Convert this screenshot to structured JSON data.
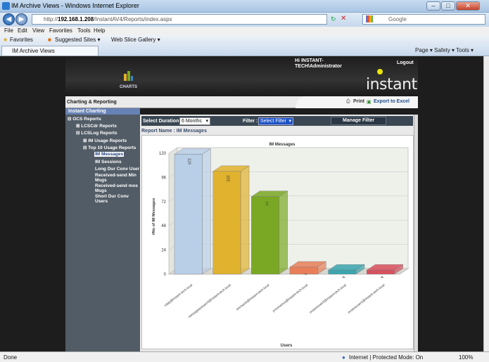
{
  "window": {
    "title": "IM Archive Views - Windows Internet Explorer",
    "min": "–",
    "max": "□",
    "close": "✕"
  },
  "address": {
    "url_prefix": "http://",
    "url_host": "192.168.1.208",
    "url_path": "/InstantAV4/Reports/index.aspx",
    "search_placeholder": "Google"
  },
  "menu": [
    "File",
    "Edit",
    "View",
    "Favorites",
    "Tools",
    "Help"
  ],
  "favorites": {
    "label": "Favorites",
    "items": [
      "Suggested Sites ▾",
      "Web Slice Gallery ▾"
    ]
  },
  "tab": {
    "label": "IM Archive Views",
    "tools": "Page ▾   Safety ▾   Tools ▾"
  },
  "header": {
    "greeting": "Hi INSTANT-\nTECH\\Administrator",
    "logout": "Logout",
    "charts_label": "CHARTS",
    "brand": "instant"
  },
  "subheader": {
    "crumb": "Charting & Reporting",
    "print": "Print",
    "export": "Export to Excel"
  },
  "sidebar": {
    "heading": "Instant Charting",
    "items": [
      {
        "label": "⊟ OCS Reports"
      },
      {
        "label": "⊞ LCSCdr Reports"
      },
      {
        "label": "⊟ LCSLog Reports"
      },
      {
        "label": "⊞ IM Usage Reports"
      },
      {
        "label": "⊟ Top 10 Usage Reports"
      },
      {
        "label": "IM Messages"
      },
      {
        "label": "IM Sessions"
      },
      {
        "label": "Long Dur Conv User"
      },
      {
        "label": "Received-send Min Msgs"
      },
      {
        "label": "Received-send mos Msgs"
      },
      {
        "label": "Short Dur Conv Users"
      }
    ]
  },
  "toolbar": {
    "duration_label": "Select Duration :",
    "duration_value": "6 Months",
    "filter_label": "Filter :",
    "filter_value": "Select Filter",
    "manage": "Manage Filter"
  },
  "report_name": "Report Name : IM Messages",
  "status": {
    "left": "Done",
    "zone": "Internet | Protected Mode: On",
    "zoom": "100%"
  },
  "colors": {
    "bar1": "#b9cfe8",
    "bar2": "#e0b22e",
    "bar3": "#7aa824",
    "bar4": "#e87f58",
    "bar5": "#3aa6b0",
    "bar6": "#d8505e"
  },
  "chart_data": {
    "type": "bar",
    "title": "IM Messages",
    "xlabel": "Users",
    "ylabel": "#No of IM Messages",
    "ylim": [
      0,
      120
    ],
    "yticks": [
      0,
      24,
      48,
      72,
      96,
      120
    ],
    "categories": [
      "rdaly@instant-tech.local",
      "messageautoarch@instant-tech.local",
      "erichards@instant-tech.local",
      "pmomanus@instant-tech.local",
      "ocstestuser2@instant-tech.local",
      "ocstestuser1@instant-tech.local"
    ],
    "values": [
      119,
      102,
      77,
      7,
      4,
      4
    ],
    "value_labels": [
      "119",
      "102",
      "77",
      "7",
      "4",
      "4"
    ]
  }
}
